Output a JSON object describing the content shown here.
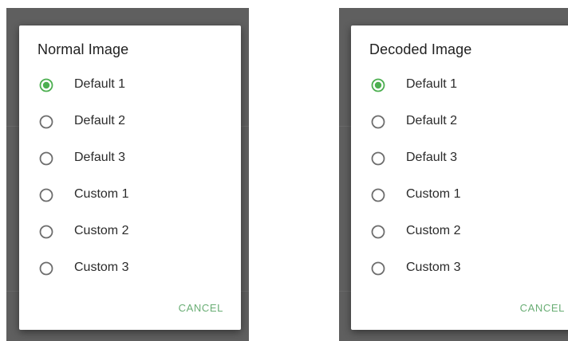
{
  "colors": {
    "accent": "#4caf50",
    "radio_unselected": "#6d6d6d",
    "scrim": "#5f5f5f",
    "cancel_text": "#6aae75"
  },
  "left_dialog": {
    "title": "Normal Image",
    "options": [
      {
        "label": "Default 1",
        "selected": true
      },
      {
        "label": "Default 2",
        "selected": false
      },
      {
        "label": "Default 3",
        "selected": false
      },
      {
        "label": "Custom 1",
        "selected": false
      },
      {
        "label": "Custom 2",
        "selected": false
      },
      {
        "label": "Custom 3",
        "selected": false
      }
    ],
    "cancel_label": "CANCEL"
  },
  "right_dialog": {
    "title": "Decoded Image",
    "options": [
      {
        "label": "Default 1",
        "selected": true
      },
      {
        "label": "Default 2",
        "selected": false
      },
      {
        "label": "Default 3",
        "selected": false
      },
      {
        "label": "Custom 1",
        "selected": false
      },
      {
        "label": "Custom 2",
        "selected": false
      },
      {
        "label": "Custom 3",
        "selected": false
      }
    ],
    "cancel_label": "CANCEL"
  }
}
